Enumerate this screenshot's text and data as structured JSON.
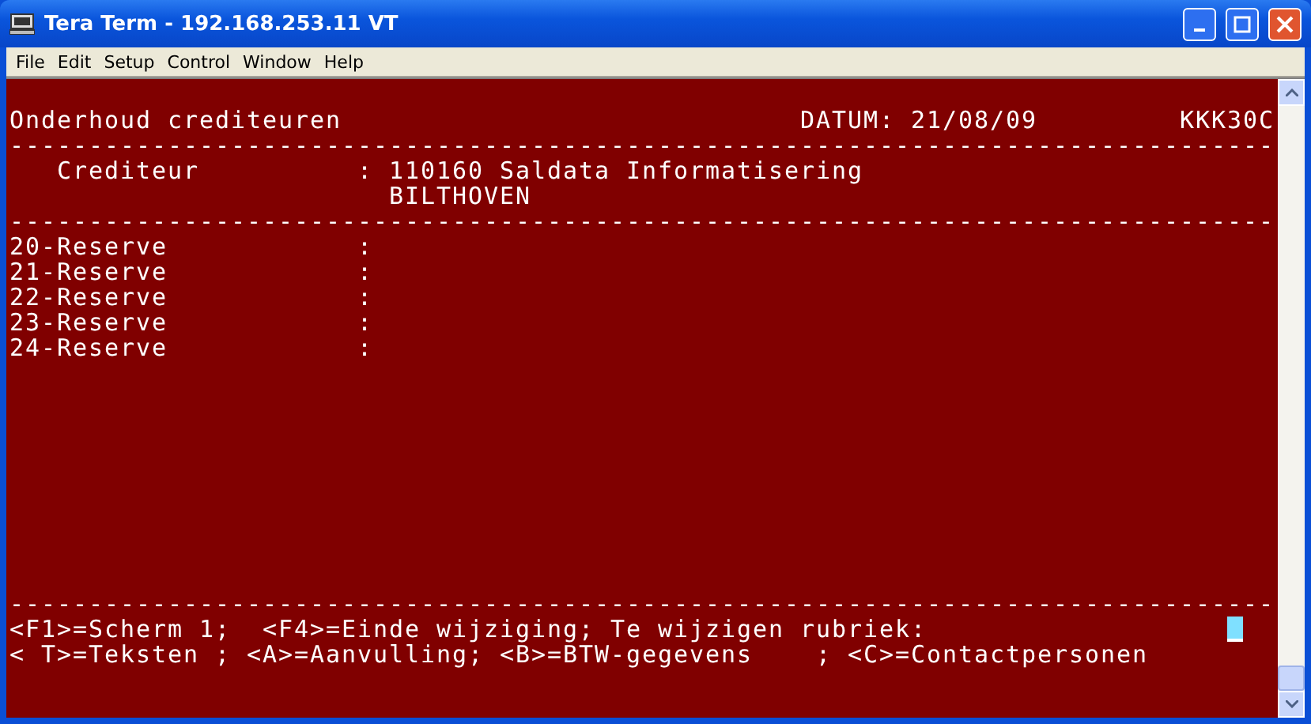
{
  "window": {
    "title": "Tera Term - 192.168.253.11 VT"
  },
  "menu": [
    "File",
    "Edit",
    "Setup",
    "Control",
    "Window",
    "Help"
  ],
  "terminal": {
    "header": {
      "title": "Onderhoud crediteuren",
      "date": "DATUM: 21/08/09",
      "program": "KKK30C"
    },
    "rule": "--------------------------------------------------------------------------------",
    "creditor": {
      "label": "Crediteur",
      "colon": ":",
      "lines": [
        "110160 Saldata Informatisering",
        "BILTHOVEN"
      ]
    },
    "fields": [
      {
        "label": "20-Reserve",
        "colon": ":"
      },
      {
        "label": "21-Reserve",
        "colon": ":"
      },
      {
        "label": "22-Reserve",
        "colon": ":"
      },
      {
        "label": "23-Reserve",
        "colon": ":"
      },
      {
        "label": "24-Reserve",
        "colon": ":"
      }
    ],
    "footer": [
      "<F1>=Scherm 1;  <F4>=Einde wijziging; Te wijzigen rubriek:",
      "< T>=Teksten ; <A>=Aanvulling; <B>=BTW-gegevens    ; <C>=Contactpersonen"
    ]
  }
}
